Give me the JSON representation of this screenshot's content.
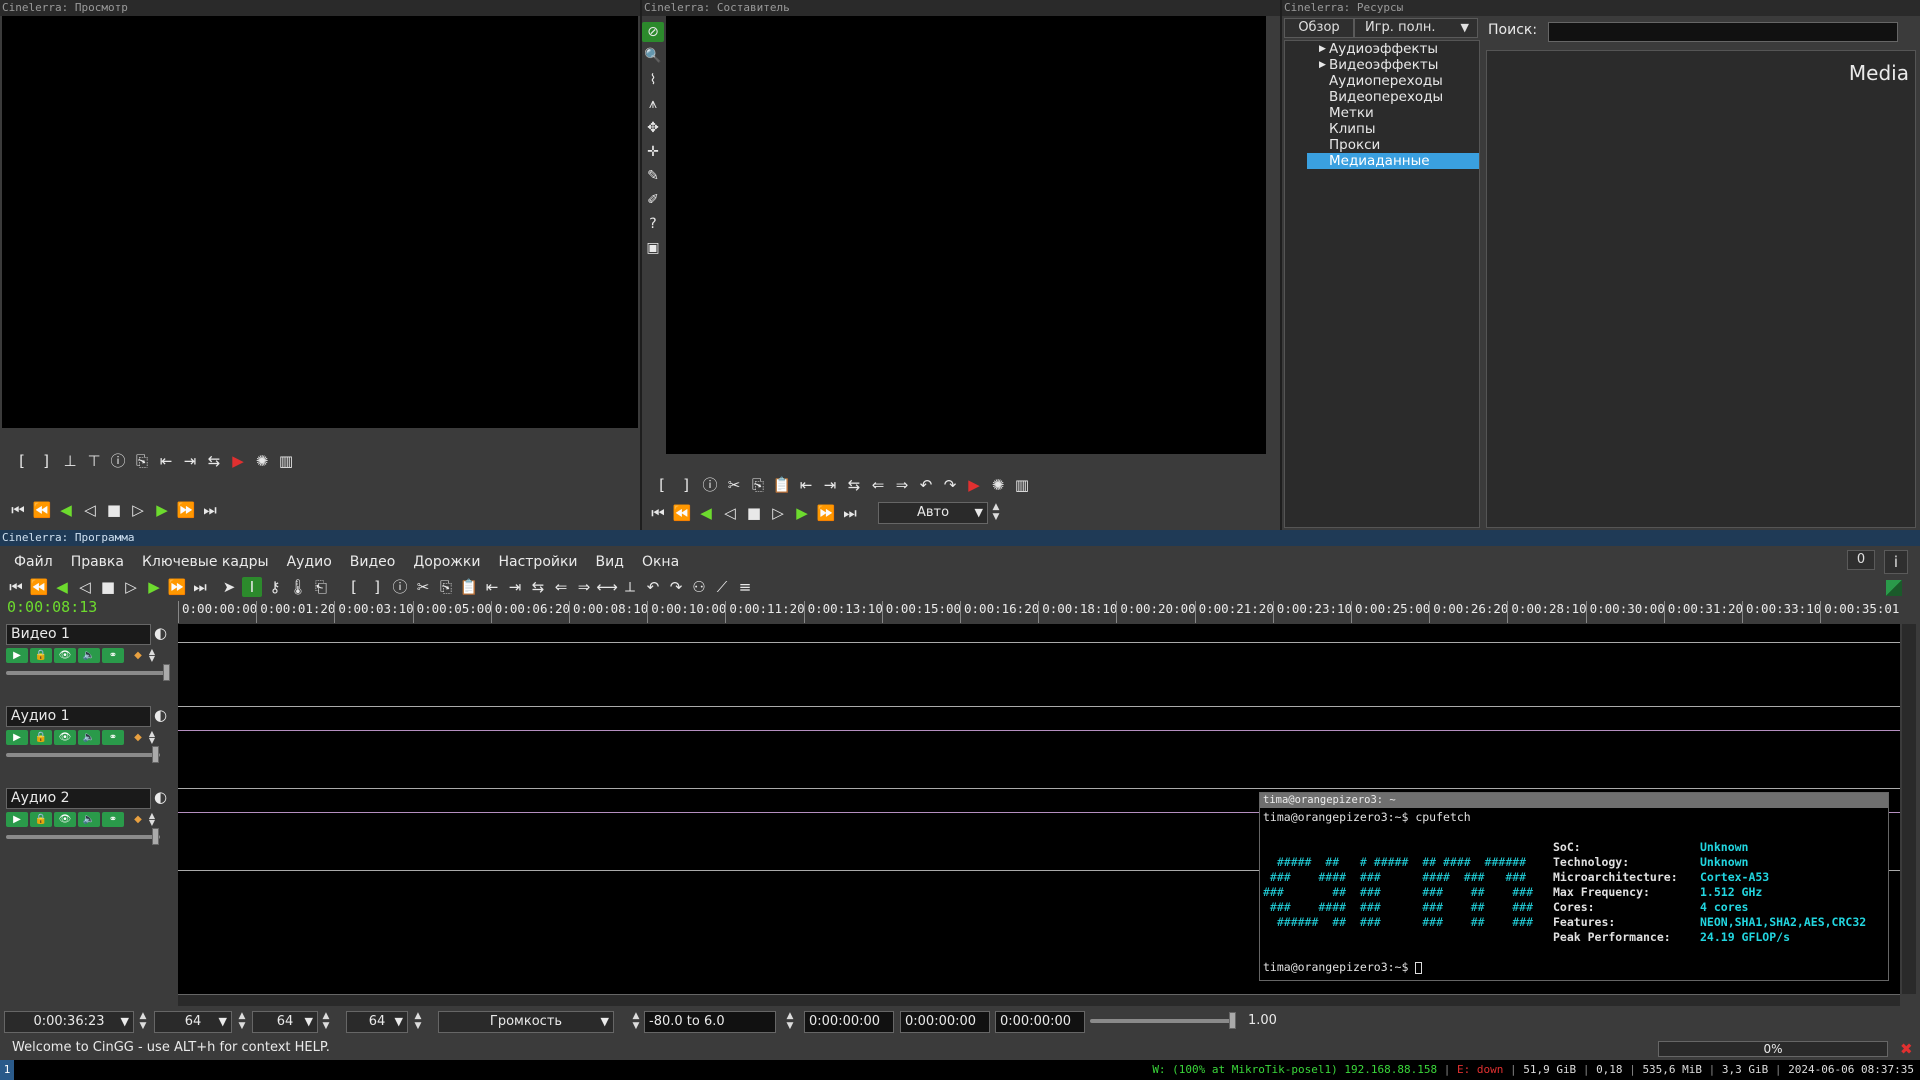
{
  "viewer": {
    "title": "Cinelerra: Просмотр"
  },
  "compositor": {
    "title": "Cinelerra: Составитель",
    "zoom": "Авто"
  },
  "resources": {
    "title": "Cinelerra: Ресурсы",
    "tab_browse": "Обзор",
    "tab_mode": "Игр. полн.",
    "search_label": "Поиск:",
    "search_value": "",
    "folders": [
      {
        "label": "Аудиоэффекты",
        "expandable": true
      },
      {
        "label": "Видеоэффекты",
        "expandable": true
      },
      {
        "label": "Аудиопереходы",
        "expandable": false
      },
      {
        "label": "Видеопереходы",
        "expandable": false
      },
      {
        "label": "Метки",
        "expandable": false
      },
      {
        "label": "Клипы",
        "expandable": false
      },
      {
        "label": "Прокси",
        "expandable": false
      },
      {
        "label": "Медиаданные",
        "expandable": false,
        "selected": true
      }
    ],
    "panel_heading": "Media"
  },
  "program": {
    "title": "Cinelerra: Программа",
    "menu": [
      "Файл",
      "Правка",
      "Ключевые кадры",
      "Аудио",
      "Видео",
      "Дорожки",
      "Настройки",
      "Вид",
      "Окна"
    ],
    "counter": "0",
    "info_label": "i",
    "current_time": "0:00:08:13",
    "ruler_ticks": [
      "0:00:00:00",
      "0:00:01:20",
      "0:00:03:10",
      "0:00:05:00",
      "0:00:06:20",
      "0:00:08:10",
      "0:00:10:00",
      "0:00:11:20",
      "0:00:13:10",
      "0:00:15:00",
      "0:00:16:20",
      "0:00:18:10",
      "0:00:20:00",
      "0:00:21:20",
      "0:00:23:10",
      "0:00:25:00",
      "0:00:26:20",
      "0:00:28:10",
      "0:00:30:00",
      "0:00:31:20",
      "0:00:33:10",
      "0:00:35:01"
    ],
    "tracks": [
      {
        "name": "Видео 1"
      },
      {
        "name": "Аудио 1"
      },
      {
        "name": "Аудио 2"
      }
    ],
    "bottom": {
      "duration": "0:00:36:23",
      "zoom_a": "64",
      "zoom_b": "64",
      "zoom_c": "64",
      "automation": "Громкость",
      "range": "-80.0 to 6.0",
      "sel_start": "0:00:00:00",
      "sel_length": "0:00:00:00",
      "sel_end": "0:00:00:00",
      "speed": "1.00"
    },
    "help_text": "Welcome to CinGG - use ALT+h for context HELP.",
    "progress": "0%",
    "progress_value": 0
  },
  "terminal": {
    "title": "tima@orangepizero3: ~",
    "prompt": "tima@orangepizero3:~$ ",
    "command": "cpufetch",
    "logo": [
      "  #####  ##   # #####  ## ####  ######",
      " ###    ####  ###      ####  ###   ###",
      "###       ##  ###      ###    ##    ###",
      " ###    ####  ###      ###    ##    ###",
      "  ######  ##  ###      ###    ##    ###"
    ],
    "fields": [
      {
        "key": "SoC:",
        "value": "Unknown"
      },
      {
        "key": "Technology:",
        "value": "Unknown"
      },
      {
        "key": "Microarchitecture:",
        "value": "Cortex-A53"
      },
      {
        "key": "Max Frequency:",
        "value": "1.512 GHz"
      },
      {
        "key": "Cores:",
        "value": "4 cores"
      },
      {
        "key": "Features:",
        "value": "NEON,SHA1,SHA2,AES,CRC32"
      },
      {
        "key": "Peak Performance:",
        "value": "24.19 GFLOP/s"
      }
    ]
  },
  "statusbar": {
    "workspace": "1",
    "wifi": "W: (100% at MikroTik-posel1) 192.168.88.158",
    "eth": "E: down",
    "disk": "51,9 GiB",
    "load": "0,18",
    "mem": "535,6 MiB",
    "swap": "3,3 GiB",
    "datetime": "2024-06-06 08:37:35"
  },
  "colors": {
    "accent_green": "#6ddb2e",
    "selection_blue": "#3aa0e0",
    "terminal_cyan": "#22d6e0",
    "record_red": "#e03030"
  }
}
